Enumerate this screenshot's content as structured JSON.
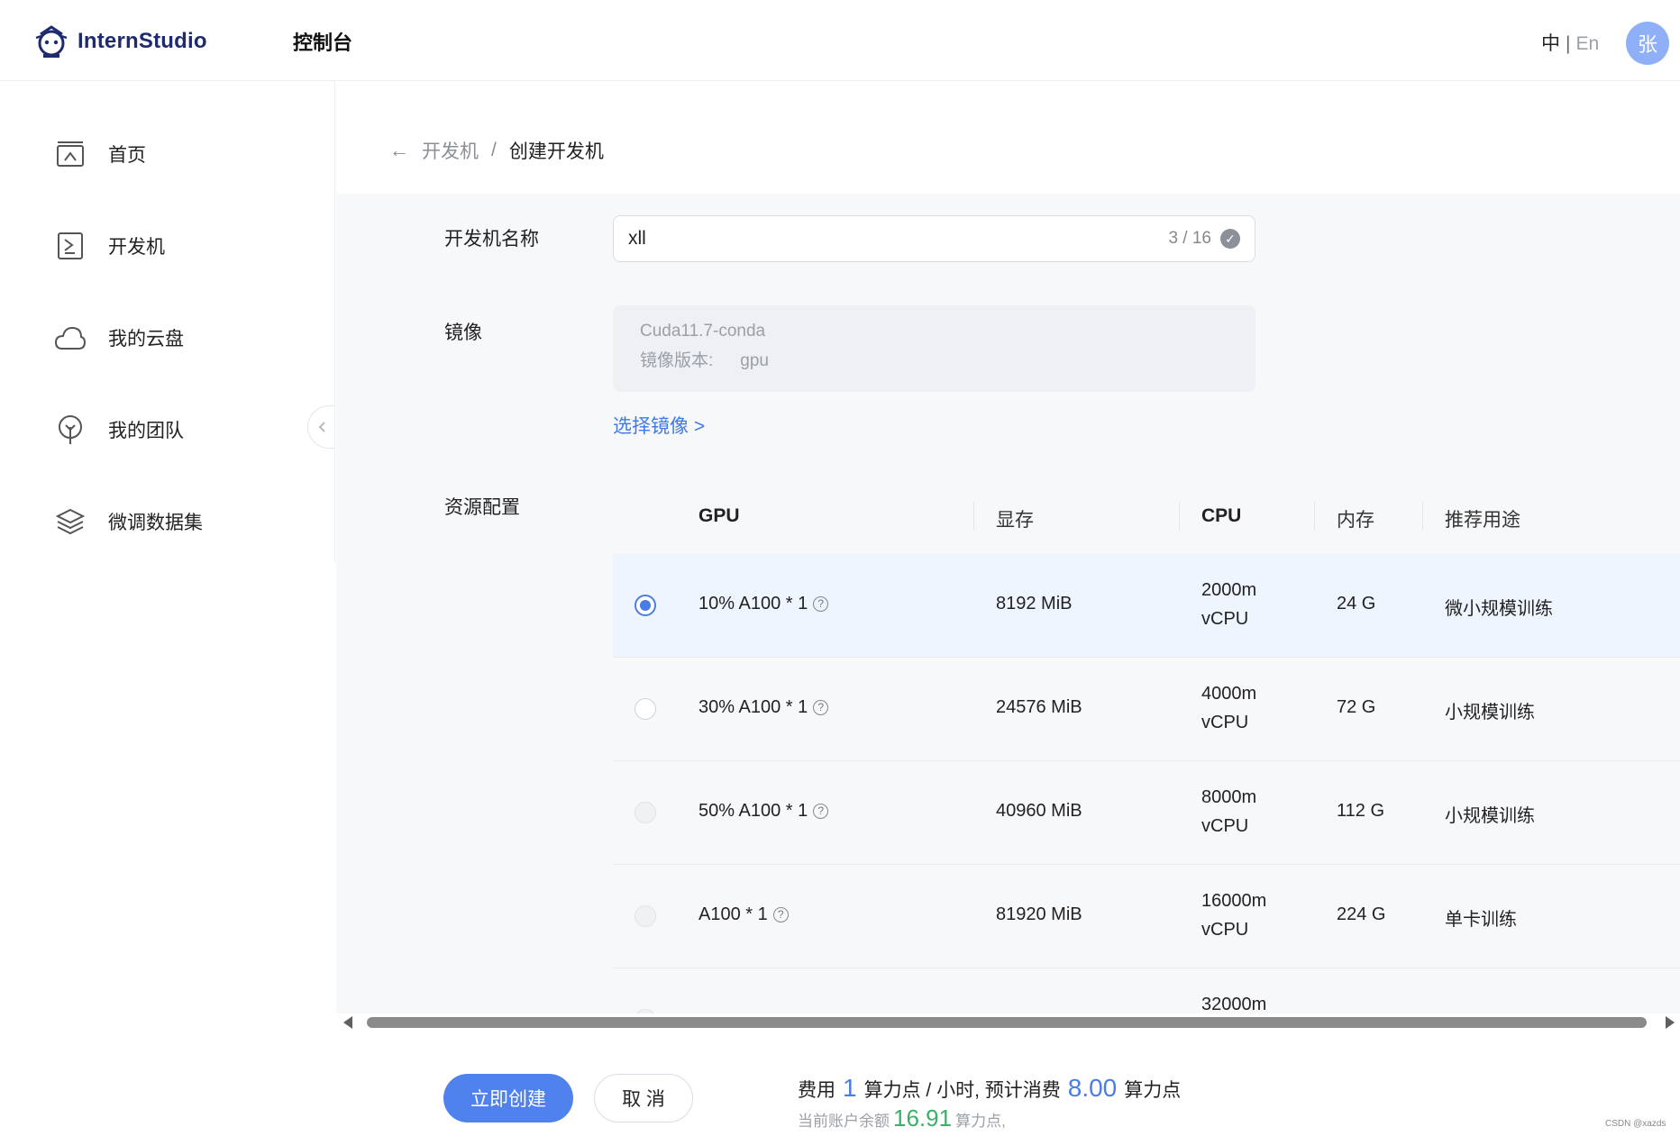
{
  "header": {
    "logo_text": "InternStudio",
    "title": "控制台",
    "lang_zh": "中",
    "lang_sep": "|",
    "lang_en": "En",
    "avatar_text": "张"
  },
  "sidebar": {
    "items": [
      {
        "label": "首页",
        "icon": "home-icon"
      },
      {
        "label": "开发机",
        "icon": "terminal-icon"
      },
      {
        "label": "我的云盘",
        "icon": "cloud-icon"
      },
      {
        "label": "我的团队",
        "icon": "team-icon"
      },
      {
        "label": "微调数据集",
        "icon": "layers-icon"
      }
    ]
  },
  "breadcrumb": {
    "parent": "开发机",
    "separator": "/",
    "current": "创建开发机"
  },
  "form": {
    "name_label": "开发机名称",
    "name_value": "xll",
    "name_count": "3 / 16",
    "image_label": "镜像",
    "image_name": "Cuda11.7-conda",
    "image_version_label": "镜像版本:",
    "image_version_value": "gpu",
    "choose_image": "选择镜像 >",
    "resource_label": "资源配置"
  },
  "table": {
    "headers": [
      "GPU",
      "显存",
      "CPU",
      "内存",
      "推荐用途"
    ],
    "rows": [
      {
        "gpu": "10% A100 * 1",
        "vram": "8192 MiB",
        "cpu_1": "2000m",
        "cpu_2": "vCPU",
        "mem": "24 G",
        "usage": "微小规模训练",
        "state": "selected"
      },
      {
        "gpu": "30% A100 * 1",
        "vram": "24576 MiB",
        "cpu_1": "4000m",
        "cpu_2": "vCPU",
        "mem": "72 G",
        "usage": "小规模训练",
        "state": "enabled"
      },
      {
        "gpu": "50% A100 * 1",
        "vram": "40960 MiB",
        "cpu_1": "8000m",
        "cpu_2": "vCPU",
        "mem": "112 G",
        "usage": "小规模训练",
        "state": "disabled"
      },
      {
        "gpu": "A100 * 1",
        "vram": "81920 MiB",
        "cpu_1": "16000m",
        "cpu_2": "vCPU",
        "mem": "224 G",
        "usage": "单卡训练",
        "state": "disabled"
      },
      {
        "gpu": "",
        "vram": "",
        "cpu_1": "32000m",
        "cpu_2": "",
        "mem": "",
        "usage": "",
        "state": "disabled"
      }
    ],
    "help_glyph": "?"
  },
  "footer": {
    "create_button": "立即创建",
    "cancel_button": "取 消",
    "cost_prefix": "费用",
    "cost_rate": "1",
    "cost_mid": "算力点 / 小时, 预计消费",
    "cost_estimate": "8.00",
    "cost_suffix": "算力点",
    "balance_prefix": "当前账户余额",
    "balance_value": "16.91",
    "balance_suffix": "算力点,"
  },
  "watermark": "CSDN @xazds",
  "colors": {
    "accent": "#4f82ec",
    "link": "#3f7ae8",
    "balance": "#3fae6a",
    "selected_row": "#eef5ff"
  }
}
